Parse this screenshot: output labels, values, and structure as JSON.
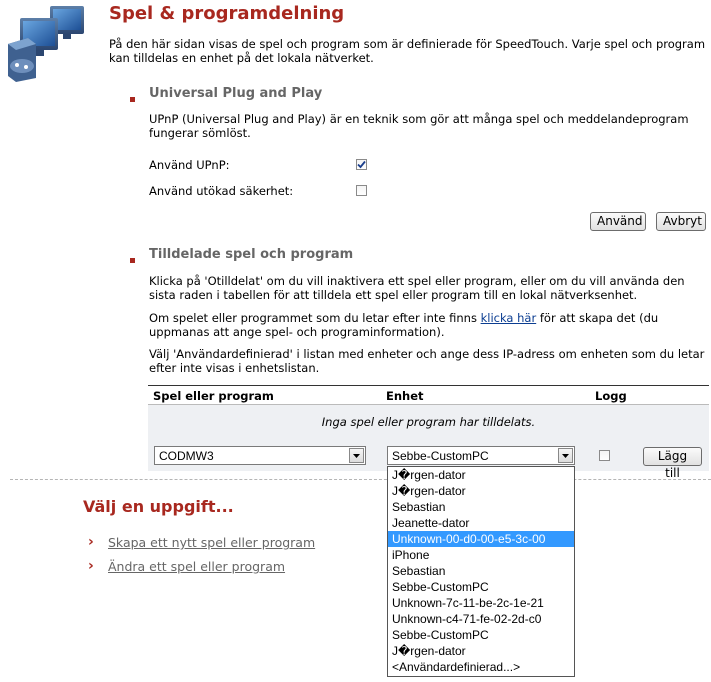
{
  "header": {
    "title": "Spel & programdelning",
    "intro": "På den här sidan visas de spel och program som är definierade för SpeedTouch. Varje spel och program kan tilldelas en enhet på det lokala nätverket."
  },
  "upnp": {
    "title": "Universal Plug and Play",
    "description": "UPnP (Universal Plug and Play) är en teknik som gör att många spel och meddelandeprogram fungerar sömlöst.",
    "use_upnp_label": "Använd UPnP:",
    "use_upnp_checked": true,
    "extended_security_label": "Använd utökad säkerhet:",
    "extended_security_checked": false,
    "apply_label": "Använd",
    "cancel_label": "Avbryt"
  },
  "assigned": {
    "title": "Tilldelade spel och program",
    "para1": "Klicka på 'Otilldelat' om du vill inaktivera ett spel eller program, eller om du vill använda den sista raden i tabellen för att tilldela ett spel eller program till en lokal nätverksenhet.",
    "para2_before": "Om spelet eller programmet som du letar efter inte finns ",
    "para2_link": "klicka här",
    "para2_after": " för att skapa det (du uppmanas att ange spel- och programinformation).",
    "para3": "Välj 'Användardefinierad' i listan med enheter och ange dess IP-adress om enheten som du letar efter inte visas i enhetslistan.",
    "table": {
      "headers": [
        "Spel eller program",
        "Enhet",
        "Logg"
      ],
      "empty_text": "Inga spel eller program har tilldelats.",
      "game_value": "CODMW3",
      "device_value": "Sebbe-CustomPC",
      "log_checked": false,
      "add_label": "Lägg till"
    },
    "device_options": [
      "J�rgen-dator",
      "J�rgen-dator",
      "Sebastian",
      "Jeanette-dator",
      "Unknown-00-d0-00-e5-3c-00",
      "iPhone",
      "Sebastian",
      "Sebbe-CustomPC",
      "Unknown-7c-11-be-2c-1e-21",
      "Unknown-c4-71-fe-02-2d-c0",
      "Sebbe-CustomPC",
      "J�rgen-dator",
      "<Användardefinierad...>"
    ],
    "highlighted_option_index": 4
  },
  "tasks": {
    "title": "Välj en uppgift...",
    "items": [
      "Skapa ett nytt spel eller program",
      "Ändra ett spel eller program"
    ]
  },
  "colors": {
    "accent": "#a8281f",
    "link": "#0b3d91",
    "highlight": "#3399ff"
  }
}
